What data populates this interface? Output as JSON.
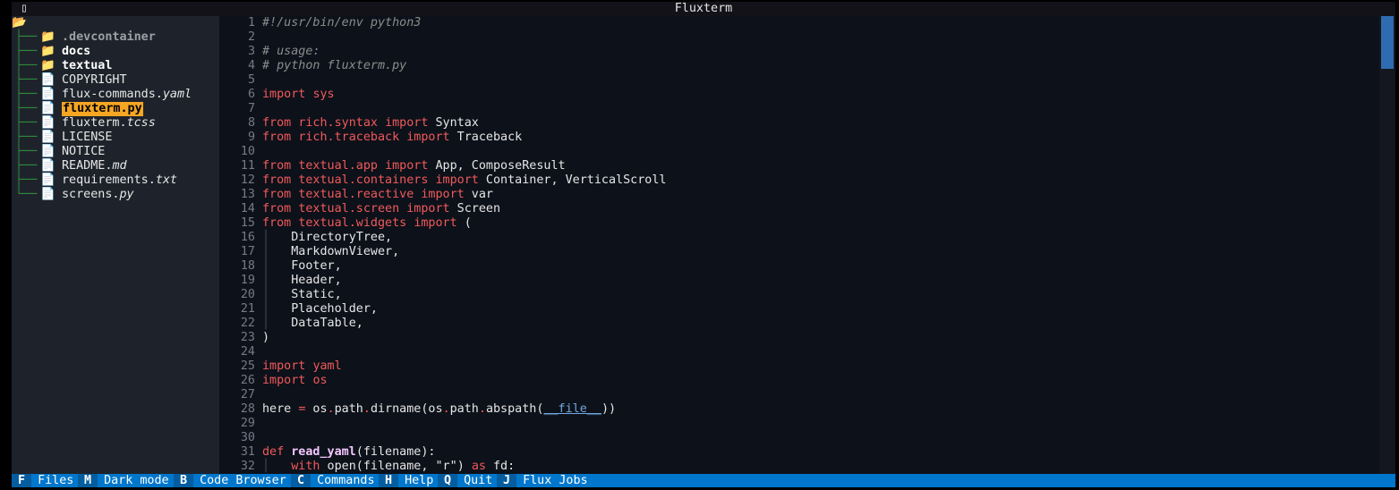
{
  "header": {
    "icon": "terminal-icon",
    "title": "Fluxterm"
  },
  "sidebar": {
    "root_icon": "open-folder-icon",
    "items": [
      {
        "icon": "folder-icon",
        "name": ".devcontainer",
        "ext": "",
        "type": "dir-dim"
      },
      {
        "icon": "folder-icon",
        "name": "docs",
        "ext": "",
        "type": "dir"
      },
      {
        "icon": "folder-icon",
        "name": "textual",
        "ext": "",
        "type": "dir"
      },
      {
        "icon": "file-icon",
        "name": "COPYRIGHT",
        "ext": "",
        "type": "file"
      },
      {
        "icon": "file-icon",
        "name": "flux-commands.",
        "ext": "yaml",
        "type": "file"
      },
      {
        "icon": "file-icon",
        "name": "fluxterm.py",
        "ext": "",
        "type": "selected"
      },
      {
        "icon": "file-icon",
        "name": "fluxterm.",
        "ext": "tcss",
        "type": "file"
      },
      {
        "icon": "file-icon",
        "name": "LICENSE",
        "ext": "",
        "type": "file"
      },
      {
        "icon": "file-icon",
        "name": "NOTICE",
        "ext": "",
        "type": "file"
      },
      {
        "icon": "file-icon",
        "name": "README.",
        "ext": "md",
        "type": "file"
      },
      {
        "icon": "file-icon",
        "name": "requirements.",
        "ext": "txt",
        "type": "file"
      },
      {
        "icon": "file-icon",
        "name": "screens.",
        "ext": "py",
        "type": "file"
      }
    ]
  },
  "editor": {
    "lines": [
      {
        "n": "1",
        "tokens": [
          [
            "com",
            "#!/usr/bin/env python3"
          ]
        ]
      },
      {
        "n": "2",
        "tokens": []
      },
      {
        "n": "3",
        "tokens": [
          [
            "com",
            "# usage:"
          ]
        ]
      },
      {
        "n": "4",
        "tokens": [
          [
            "com",
            "# python fluxterm.py"
          ]
        ]
      },
      {
        "n": "5",
        "tokens": []
      },
      {
        "n": "6",
        "tokens": [
          [
            "kw",
            "import"
          ],
          [
            "ident",
            " "
          ],
          [
            "mod",
            "sys"
          ]
        ]
      },
      {
        "n": "7",
        "tokens": []
      },
      {
        "n": "8",
        "tokens": [
          [
            "kw",
            "from"
          ],
          [
            "ident",
            " "
          ],
          [
            "mod",
            "rich.syntax"
          ],
          [
            "ident",
            " "
          ],
          [
            "kw",
            "import"
          ],
          [
            "ident",
            " Syntax"
          ]
        ]
      },
      {
        "n": "9",
        "tokens": [
          [
            "kw",
            "from"
          ],
          [
            "ident",
            " "
          ],
          [
            "mod",
            "rich.traceback"
          ],
          [
            "ident",
            " "
          ],
          [
            "kw",
            "import"
          ],
          [
            "ident",
            " Traceback"
          ]
        ]
      },
      {
        "n": "10",
        "tokens": []
      },
      {
        "n": "11",
        "tokens": [
          [
            "kw",
            "from"
          ],
          [
            "ident",
            " "
          ],
          [
            "mod",
            "textual.app"
          ],
          [
            "ident",
            " "
          ],
          [
            "kw",
            "import"
          ],
          [
            "ident",
            " App, ComposeResult"
          ]
        ]
      },
      {
        "n": "12",
        "tokens": [
          [
            "kw",
            "from"
          ],
          [
            "ident",
            " "
          ],
          [
            "mod",
            "textual.containers"
          ],
          [
            "ident",
            " "
          ],
          [
            "kw",
            "import"
          ],
          [
            "ident",
            " Container, VerticalScroll"
          ]
        ]
      },
      {
        "n": "13",
        "tokens": [
          [
            "kw",
            "from"
          ],
          [
            "ident",
            " "
          ],
          [
            "mod",
            "textual.reactive"
          ],
          [
            "ident",
            " "
          ],
          [
            "kw",
            "import"
          ],
          [
            "ident",
            " var"
          ]
        ]
      },
      {
        "n": "14",
        "tokens": [
          [
            "kw",
            "from"
          ],
          [
            "ident",
            " "
          ],
          [
            "mod",
            "textual.screen"
          ],
          [
            "ident",
            " "
          ],
          [
            "kw",
            "import"
          ],
          [
            "ident",
            " Screen"
          ]
        ]
      },
      {
        "n": "15",
        "tokens": [
          [
            "kw",
            "from"
          ],
          [
            "ident",
            " "
          ],
          [
            "mod",
            "textual.widgets"
          ],
          [
            "ident",
            " "
          ],
          [
            "kw",
            "import"
          ],
          [
            "ident",
            " ("
          ]
        ]
      },
      {
        "n": "16",
        "tokens": [
          [
            "indent",
            "│   "
          ],
          [
            "ident",
            "DirectoryTree,"
          ]
        ]
      },
      {
        "n": "17",
        "tokens": [
          [
            "indent",
            "│   "
          ],
          [
            "ident",
            "MarkdownViewer,"
          ]
        ]
      },
      {
        "n": "18",
        "tokens": [
          [
            "indent",
            "│   "
          ],
          [
            "ident",
            "Footer,"
          ]
        ]
      },
      {
        "n": "19",
        "tokens": [
          [
            "indent",
            "│   "
          ],
          [
            "ident",
            "Header,"
          ]
        ]
      },
      {
        "n": "20",
        "tokens": [
          [
            "indent",
            "│   "
          ],
          [
            "ident",
            "Static,"
          ]
        ]
      },
      {
        "n": "21",
        "tokens": [
          [
            "indent",
            "│   "
          ],
          [
            "ident",
            "Placeholder,"
          ]
        ]
      },
      {
        "n": "22",
        "tokens": [
          [
            "indent",
            "│   "
          ],
          [
            "ident",
            "DataTable,"
          ]
        ]
      },
      {
        "n": "23",
        "tokens": [
          [
            "ident",
            ")"
          ]
        ]
      },
      {
        "n": "24",
        "tokens": []
      },
      {
        "n": "25",
        "tokens": [
          [
            "kw",
            "import"
          ],
          [
            "ident",
            " "
          ],
          [
            "mod",
            "yaml"
          ]
        ]
      },
      {
        "n": "26",
        "tokens": [
          [
            "kw",
            "import"
          ],
          [
            "ident",
            " "
          ],
          [
            "mod",
            "os"
          ]
        ]
      },
      {
        "n": "27",
        "tokens": []
      },
      {
        "n": "28",
        "tokens": [
          [
            "ident",
            "here "
          ],
          [
            "op",
            "="
          ],
          [
            "ident",
            " os"
          ],
          [
            "op",
            "."
          ],
          [
            "ident",
            "path"
          ],
          [
            "op",
            "."
          ],
          [
            "ident",
            "dirname(os"
          ],
          [
            "op",
            "."
          ],
          [
            "ident",
            "path"
          ],
          [
            "op",
            "."
          ],
          [
            "ident",
            "abspath("
          ],
          [
            "dunder",
            "__file__"
          ],
          [
            "ident",
            "))"
          ]
        ]
      },
      {
        "n": "29",
        "tokens": []
      },
      {
        "n": "30",
        "tokens": []
      },
      {
        "n": "31",
        "tokens": [
          [
            "kw",
            "def"
          ],
          [
            "ident",
            " "
          ],
          [
            "fn",
            "read_yaml"
          ],
          [
            "ident",
            "(filename):"
          ]
        ]
      },
      {
        "n": "32",
        "tokens": [
          [
            "indent",
            "│   "
          ],
          [
            "kw",
            "with"
          ],
          [
            "ident",
            " open(filename, "
          ],
          [
            "strlit",
            "\"r\""
          ],
          [
            "ident",
            ") "
          ],
          [
            "kw",
            "as"
          ],
          [
            "ident",
            " fd:"
          ]
        ]
      }
    ]
  },
  "footer": {
    "bindings": [
      {
        "key": "F",
        "label": "Files"
      },
      {
        "key": "M",
        "label": "Dark mode"
      },
      {
        "key": "B",
        "label": "Code Browser"
      },
      {
        "key": "C",
        "label": "Commands"
      },
      {
        "key": "H",
        "label": "Help"
      },
      {
        "key": "Q",
        "label": "Quit"
      },
      {
        "key": "J",
        "label": "Flux Jobs"
      }
    ]
  },
  "colors": {
    "accent": "#0077cc",
    "selection": "#f5a623",
    "keyword": "#f05a5a",
    "guides": "#2e8b3c"
  }
}
